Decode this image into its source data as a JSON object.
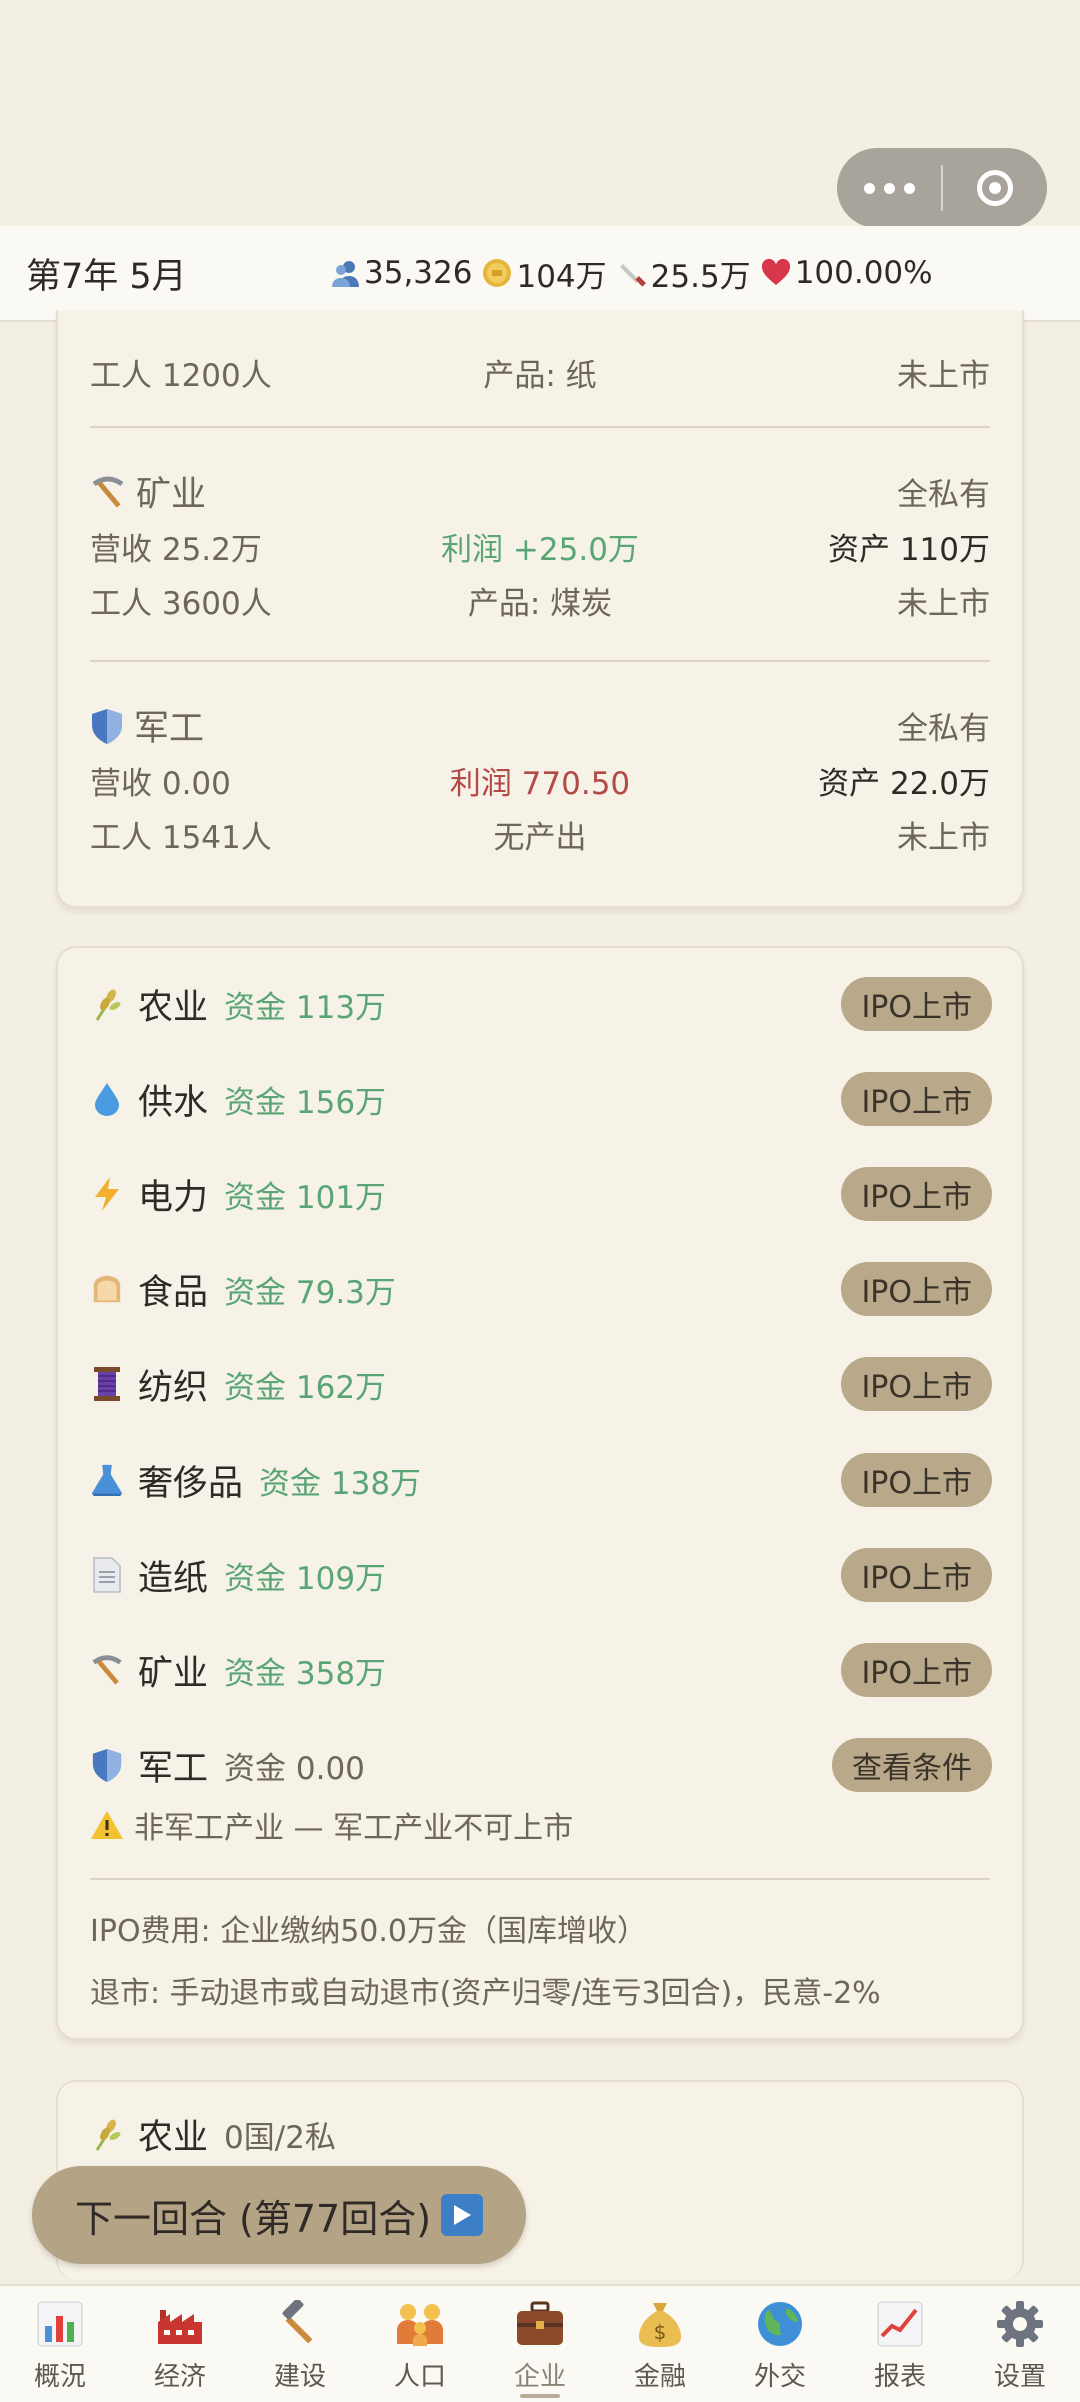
{
  "capsule": {
    "more_icon": "more-dots-icon",
    "close_icon": "target-circle-icon"
  },
  "topbar": {
    "date": "第7年 5月",
    "population": "35,326",
    "gold": "104万",
    "military": "25.5万",
    "approval": "100.00%"
  },
  "enterprises_top": {
    "paper_partial": {
      "workers": "工人 1200人",
      "product": "产品: 纸",
      "listing": "未上市"
    },
    "mining": {
      "name": "矿业",
      "ownership": "全私有",
      "revenue": "营收 25.2万",
      "profit": "利润 +25.0万",
      "assets": "资产 110万",
      "workers": "工人 3600人",
      "product": "产品: 煤炭",
      "listing": "未上市"
    },
    "military": {
      "name": "军工",
      "ownership": "全私有",
      "revenue": "营收 0.00",
      "profit": "利润 770.50",
      "assets": "资产 22.0万",
      "workers": "工人 1541人",
      "product": "无产出",
      "listing": "未上市"
    }
  },
  "ipo": {
    "items": [
      {
        "name": "农业",
        "fund": "资金 113万",
        "action": "IPO上市",
        "icon": "wheat-icon"
      },
      {
        "name": "供水",
        "fund": "资金 156万",
        "action": "IPO上市",
        "icon": "water-drop-icon"
      },
      {
        "name": "电力",
        "fund": "资金 101万",
        "action": "IPO上市",
        "icon": "lightning-icon"
      },
      {
        "name": "食品",
        "fund": "资金 79.3万",
        "action": "IPO上市",
        "icon": "bread-icon"
      },
      {
        "name": "纺织",
        "fund": "资金 162万",
        "action": "IPO上市",
        "icon": "thread-spool-icon"
      },
      {
        "name": "奢侈品",
        "fund": "资金 138万",
        "action": "IPO上市",
        "icon": "dress-icon"
      },
      {
        "name": "造纸",
        "fund": "资金 109万",
        "action": "IPO上市",
        "icon": "document-icon"
      },
      {
        "name": "矿业",
        "fund": "资金 358万",
        "action": "IPO上市",
        "icon": "pickaxe-icon"
      },
      {
        "name": "军工",
        "fund": "资金 0.00",
        "action": "查看条件",
        "icon": "shield-icon"
      }
    ],
    "warning": "非军工产业 — 军工产业不可上市",
    "fee_note": "IPO费用: 企业缴纳50.0万金（国库增收）",
    "delist_note": "退市: 手动退市或自动退市(资产归零/连亏3回合)，民意-2%"
  },
  "ownership_preview": {
    "name": "农业",
    "count": "0国/2私"
  },
  "next_turn": {
    "label": "下一回合 (第77回合)"
  },
  "tabs": [
    {
      "label": "概況",
      "icon": "bar-chart-icon"
    },
    {
      "label": "经济",
      "icon": "factory-icon"
    },
    {
      "label": "建设",
      "icon": "hammer-icon"
    },
    {
      "label": "人口",
      "icon": "family-icon"
    },
    {
      "label": "企业",
      "icon": "briefcase-icon"
    },
    {
      "label": "金融",
      "icon": "money-bag-icon"
    },
    {
      "label": "外交",
      "icon": "globe-icon"
    },
    {
      "label": "报表",
      "icon": "line-chart-icon"
    },
    {
      "label": "设置",
      "icon": "gear-icon"
    }
  ],
  "colors": {
    "background": "#f3efe3",
    "profit_green": "#5aa575",
    "loss_red": "#b24a46",
    "pill": "#b9a98a"
  }
}
